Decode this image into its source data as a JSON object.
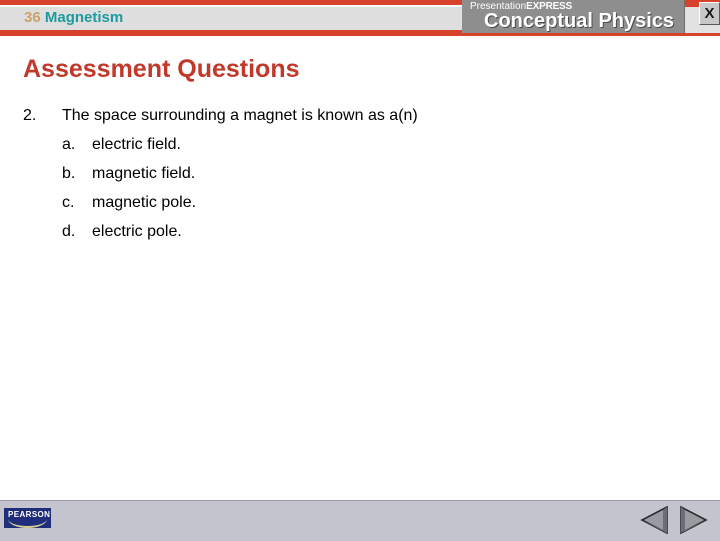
{
  "header": {
    "chapter_number": "36",
    "chapter_title": "Magnetism",
    "brand_sub_thin": "Presentation",
    "brand_sub_bold": "EXPRESS",
    "brand_main": "Conceptual Physics",
    "close_label": "X",
    "colors": {
      "red_bar": "#D8412B",
      "band": "#DEDEDE",
      "chapter_number": "#C9A36A",
      "chapter_title": "#1C9BA0",
      "logo_box": "#8E8E8E"
    }
  },
  "main": {
    "title": "Assessment Questions",
    "title_color": "#C0392B",
    "question": {
      "number": "2.",
      "text": "The space surrounding a magnet is known as a(n)"
    },
    "choices": [
      {
        "letter": "a.",
        "text": "electric field."
      },
      {
        "letter": "b.",
        "text": "magnetic field."
      },
      {
        "letter": "c.",
        "text": "magnetic pole."
      },
      {
        "letter": "d.",
        "text": "electric pole."
      }
    ]
  },
  "footer": {
    "publisher": "PEARSON",
    "publisher_bg": "#1F2D7A",
    "bar_color": "#C3C4CE",
    "nav_prev_label": "Previous slide",
    "nav_next_label": "Next slide"
  },
  "decoration": {
    "dot_color": "#C0392B"
  }
}
